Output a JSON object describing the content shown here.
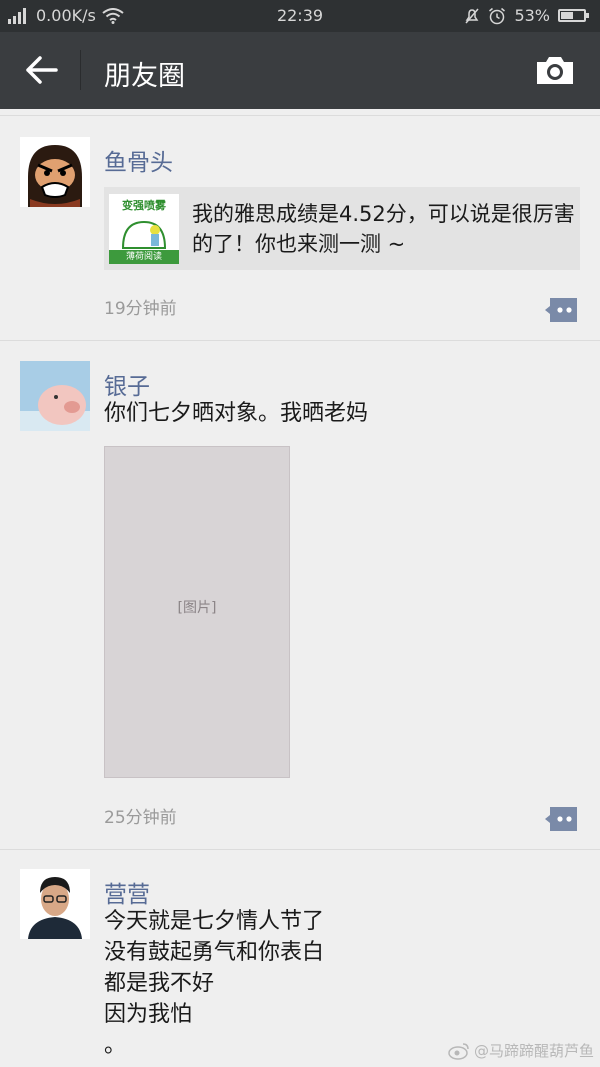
{
  "status_bar": {
    "network": "0.00K/s",
    "time": "22:39",
    "battery": "53%",
    "battery_level": 0.53
  },
  "header": {
    "title": "朋友圈",
    "back_icon": "arrow-left-icon",
    "camera_icon": "camera-icon"
  },
  "posts": [
    {
      "nickname": "鱼骨头",
      "link_card": {
        "thumb_top": "变强喷雾",
        "thumb_bottom": "薄荷阅读",
        "text": "我的雅思成绩是4.52分，可以说是很厉害的了！你也来测一测 ~"
      },
      "time": "19分钟前"
    },
    {
      "nickname": "银子",
      "text": "你们七夕晒对象。我晒老妈",
      "photo_note": "[图片]",
      "time": "25分钟前"
    },
    {
      "nickname": "营营",
      "text": "今天就是七夕情人节了\n没有鼓起勇气和你表白\n都是我不好\n因为我怕\n。"
    }
  ],
  "watermark": "@马蹄蹄醒葫芦鱼"
}
